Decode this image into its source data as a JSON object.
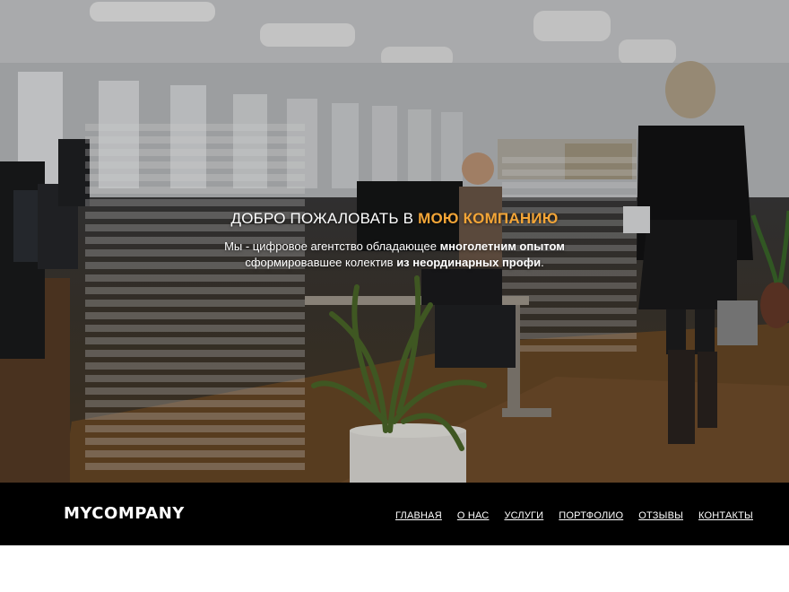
{
  "hero": {
    "title_prefix": "ДОБРО ПОЖАЛОВАТЬ В ",
    "title_accent": "МОЮ КОМПАНИЮ",
    "subtitle_line1_start": "Мы - цифровое агентство обладающее ",
    "subtitle_line1_bold": "многолетним опытом",
    "subtitle_line2_start": "сформировавшее колектив ",
    "subtitle_line2_bold": "из неординарных профи",
    "subtitle_line2_end": ".",
    "accent_color": "#f3a537"
  },
  "navbar": {
    "brand": "MYCOMPANY",
    "links": [
      {
        "label": "ГЛАВНАЯ"
      },
      {
        "label": "О НАС"
      },
      {
        "label": "УСЛУГИ"
      },
      {
        "label": "ПОРТФОЛИО"
      },
      {
        "label": "ОТЗЫВЫ"
      },
      {
        "label": "КОНТАКТЫ"
      }
    ],
    "background_color": "#000000"
  }
}
